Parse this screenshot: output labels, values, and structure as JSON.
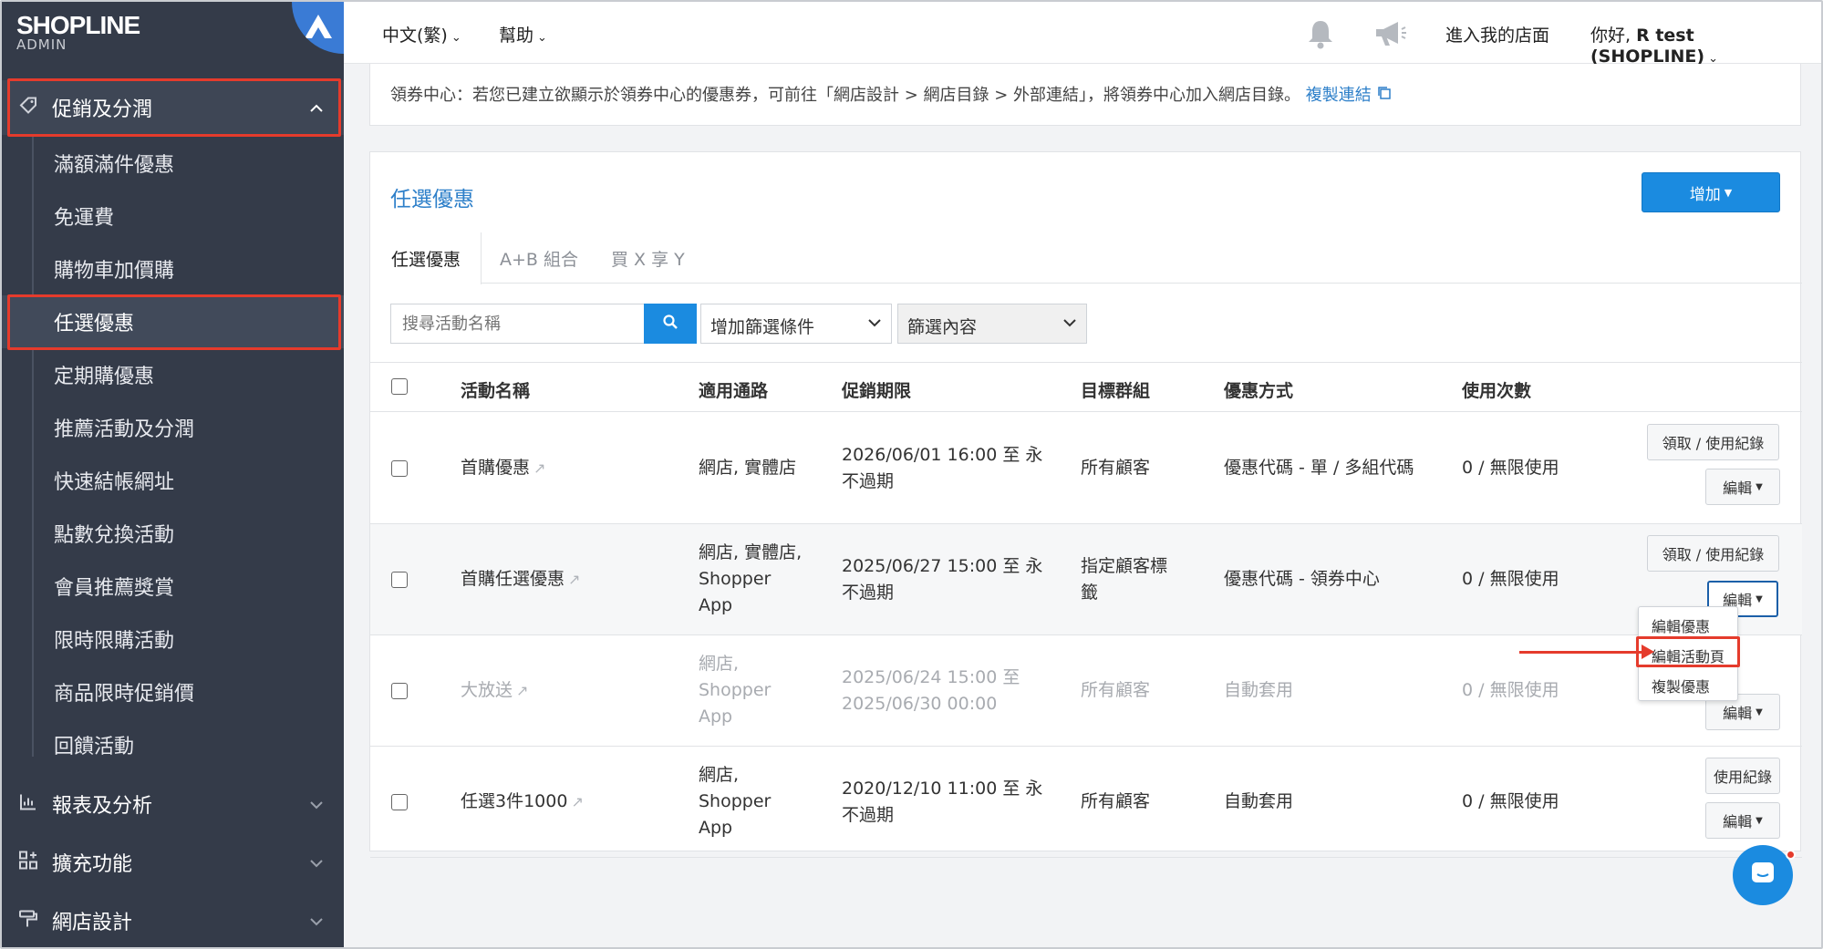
{
  "brand": {
    "name": "SHOPLINE",
    "sub": "ADMIN"
  },
  "sidebar": {
    "section_promo": "促銷及分潤",
    "sub_items": [
      "滿額滿件優惠",
      "免運費",
      "購物車加價購",
      "任選優惠",
      "定期購優惠",
      "推薦活動及分潤",
      "快速結帳網址",
      "點數兌換活動",
      "會員推薦獎賞",
      "限時限購活動",
      "商品限時促銷價",
      "回饋活動"
    ],
    "section_reports": "報表及分析",
    "section_ext": "擴充功能",
    "section_design": "網店設計"
  },
  "topbar": {
    "lang": "中文(繁)",
    "help": "幫助",
    "store": "進入我的店面",
    "greeting_prefix": "你好, ",
    "user": "R test (SHOPLINE)"
  },
  "notice": {
    "text": "領券中心：若您已建立欲顯示於領券中心的優惠券，可前往「網店設計 > 網店目錄 > 外部連結」，將領券中心加入網店目錄。",
    "link": "複製連結"
  },
  "panel": {
    "title": "任選優惠",
    "add_button": "增加",
    "tabs": [
      "任選優惠",
      "A+B 組合",
      "買 X 享 Y"
    ],
    "search_placeholder": "搜尋活動名稱",
    "filter_select": "增加篩選條件",
    "filter_content": "篩選內容"
  },
  "table": {
    "headers": [
      "活動名稱",
      "適用通路",
      "促銷期限",
      "目標群組",
      "優惠方式",
      "使用次數"
    ],
    "rows": [
      {
        "name": "首購優惠",
        "channel": "網店, 實體店",
        "period": "2026/06/01 16:00 至 永\n不過期",
        "target": "所有顧客",
        "method": "優惠代碼 - 單 / 多組代碼",
        "usage": "0 / 無限使用",
        "btn_top": "領取 / 使用紀錄",
        "btn_edit": "編輯"
      },
      {
        "name": "首購任選優惠",
        "channel": "網店, 實體店,\nShopper\nApp",
        "period": "2025/06/27 15:00 至 永\n不過期",
        "target": "指定顧客標\n籤",
        "method": "優惠代碼 - 領券中心",
        "usage": "0 / 無限使用",
        "btn_top": "領取 / 使用紀錄",
        "btn_edit": "編輯"
      },
      {
        "name": "大放送",
        "channel": "網店,\nShopper\nApp",
        "period": "2025/06/24 15:00 至\n2025/06/30 00:00",
        "target": "所有顧客",
        "method": "自動套用",
        "usage": "0 / 無限使用",
        "btn_top": "",
        "btn_edit": "編輯"
      },
      {
        "name": "任選3件1000",
        "channel": "網店,\nShopper\nApp",
        "period": "2020/12/10 11:00 至 永\n不過期",
        "target": "所有顧客",
        "method": "自動套用",
        "usage": "0 / 無限使用",
        "btn_top": "使用紀錄",
        "btn_edit": "編輯"
      }
    ]
  },
  "dropdown": {
    "items": [
      "編輯優惠",
      "編輯活動頁",
      "複製優惠"
    ]
  },
  "colors": {
    "accent": "#1b8be0",
    "sidebar": "#343b49",
    "highlight": "#e53b2c",
    "link": "#2d7fc9"
  }
}
